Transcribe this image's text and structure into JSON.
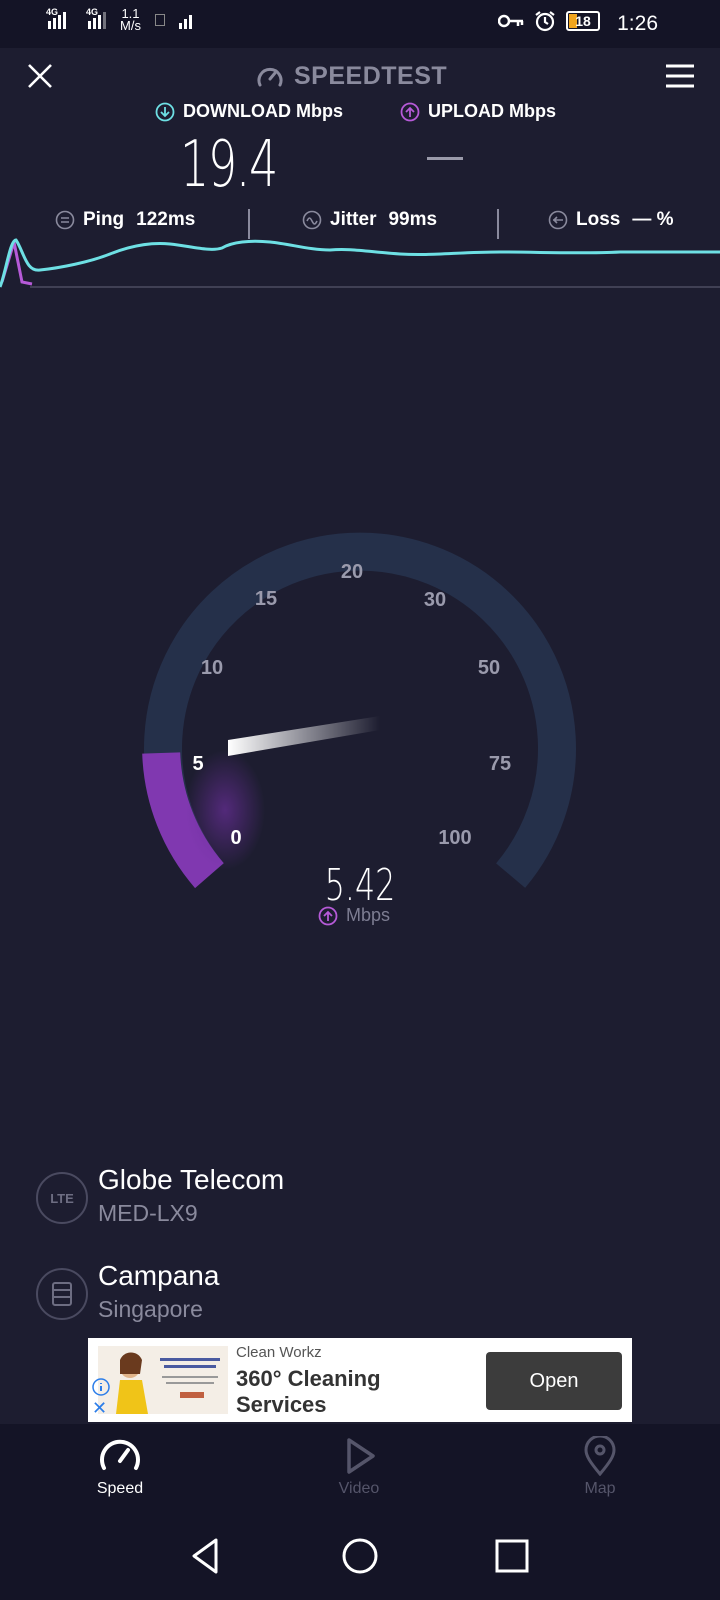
{
  "status_bar": {
    "network1": "4G",
    "network2": "4G",
    "speed_value": "1.1",
    "speed_unit": "M/s",
    "battery": "18",
    "time": "1:26"
  },
  "header": {
    "title": "SPEEDTEST"
  },
  "results": {
    "download_label": "DOWNLOAD Mbps",
    "upload_label": "UPLOAD Mbps",
    "download_value": "19.4",
    "upload_value": "—"
  },
  "stats": {
    "ping_label": "Ping",
    "ping_value": "122ms",
    "jitter_label": "Jitter",
    "jitter_value": "99ms",
    "loss_label": "Loss",
    "loss_value": "— %"
  },
  "gauge": {
    "ticks": [
      "0",
      "5",
      "10",
      "15",
      "20",
      "30",
      "50",
      "75",
      "100"
    ],
    "value": "5.42",
    "unit": "Mbps",
    "current_mbps": 5.42
  },
  "connection": {
    "provider": "Globe Telecom",
    "device": "MED-LX9",
    "provider_icon_text": "LTE",
    "server": "Campana",
    "server_location": "Singapore"
  },
  "ad": {
    "advertiser": "Clean Workz",
    "headline": "360° Cleaning Services",
    "cta": "Open"
  },
  "tabs": [
    {
      "label": "Speed",
      "icon": "speedometer-icon"
    },
    {
      "label": "Video",
      "icon": "play-icon"
    },
    {
      "label": "Map",
      "icon": "map-pin-icon"
    }
  ],
  "colors": {
    "background": "#1d1d30",
    "download_accent": "#6ee0e4",
    "upload_accent": "#b65ad8",
    "gauge_track": "#25304a",
    "gauge_fill": "#8038b0"
  }
}
